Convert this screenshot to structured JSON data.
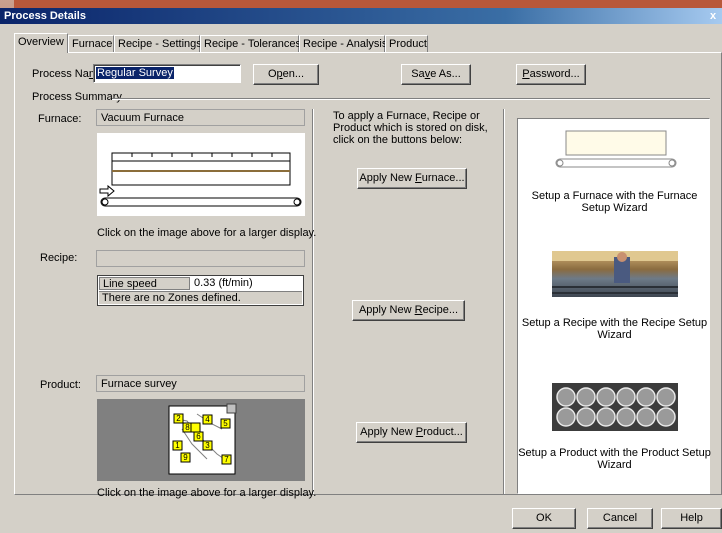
{
  "window": {
    "title": "Process Details",
    "close": "x"
  },
  "tabs": [
    {
      "label": "Overview",
      "active": true
    },
    {
      "label": "Furnace"
    },
    {
      "label": "Recipe - Settings"
    },
    {
      "label": "Recipe - Tolerances"
    },
    {
      "label": "Recipe - Analysis"
    },
    {
      "label": "Product"
    }
  ],
  "process": {
    "name_label": "Process Name:",
    "name_value": "Regular Survey",
    "open_button": "Open...",
    "save_as_button": "Save As...",
    "password_button": "Password..."
  },
  "summary": {
    "title": "Process Summary",
    "furnace_label": "Furnace:",
    "furnace_value": "Vacuum Furnace",
    "furnace_caption": "Click on the image above for a larger display.",
    "recipe_label": "Recipe:",
    "recipe_value": "",
    "line_speed_label": "Line speed",
    "line_speed_value": "0.33 (ft/min)",
    "no_zones": "There are no Zones defined.",
    "product_label": "Product:",
    "product_value": "Furnace survey",
    "product_caption": "Click on the image above for a larger display.",
    "probe_numbers": [
      "1",
      "2",
      "3",
      "4",
      "5",
      "6",
      "7",
      "8",
      "9"
    ]
  },
  "apply": {
    "instructions": "To apply a Furnace, Recipe or Product which is stored on disk, click on the buttons below:",
    "furnace_button": "Apply New Furnace...",
    "recipe_button": "Apply New Recipe...",
    "product_button": "Apply New Product..."
  },
  "wizards": {
    "furnace": "Setup a Furnace with the Furnace Setup Wizard",
    "recipe": "Setup a Recipe with the Recipe Setup Wizard",
    "product": "Setup a Product with the Product Setup Wizard"
  },
  "footer": {
    "ok": "OK",
    "cancel": "Cancel",
    "help": "Help"
  }
}
